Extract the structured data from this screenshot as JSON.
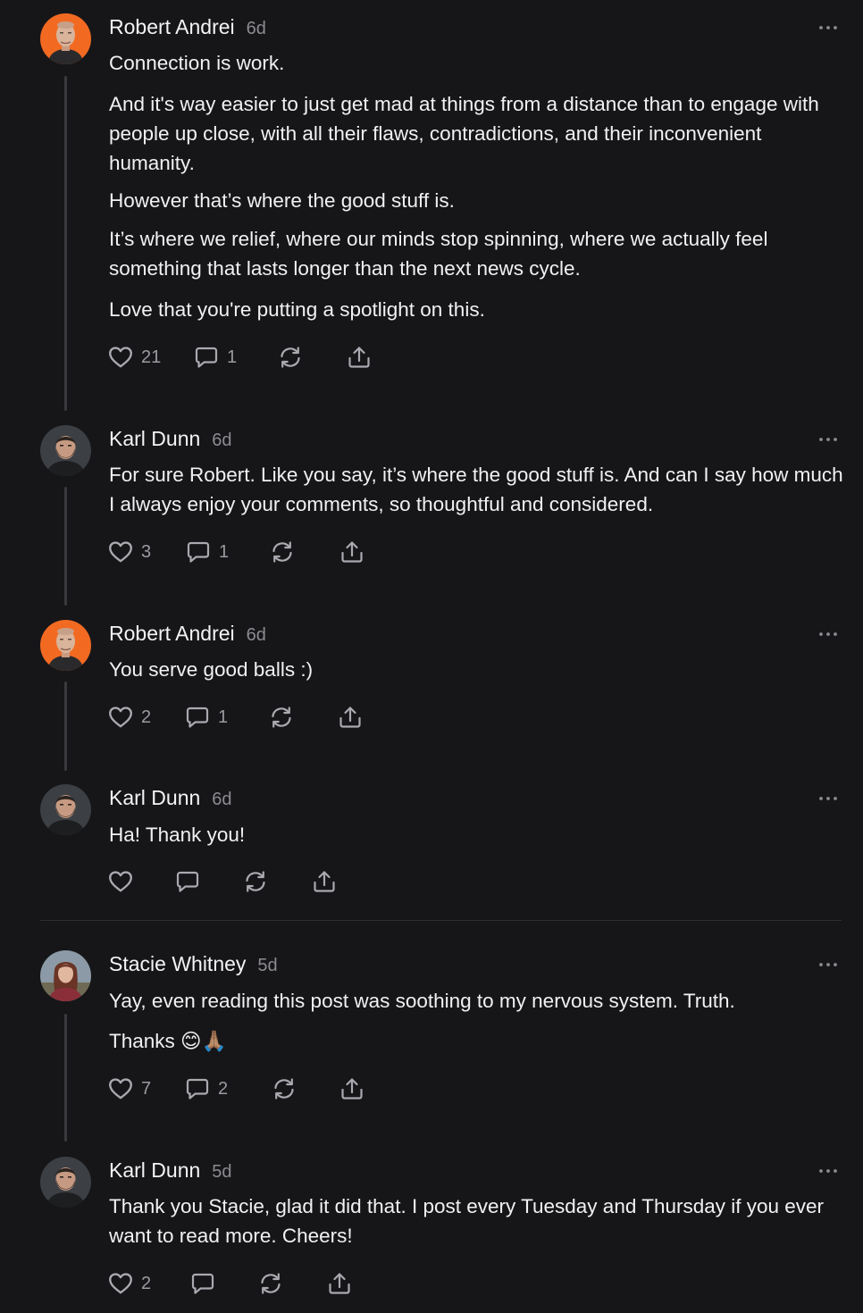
{
  "comments": [
    {
      "author": "Robert Andrei",
      "time": "6d",
      "paragraphs": [
        "Connection is work.",
        "And it's way easier to just get mad at things from a distance than to engage with people up close, with all their flaws, contradictions, and their inconvenient humanity.",
        "However that’s where the good stuff is.",
        "It’s where we relief, where our minds stop spinning, where we actually feel something that lasts longer than the next news cycle.",
        "Love that you're putting a spotlight on this."
      ],
      "likes": "21",
      "replies": "1"
    },
    {
      "author": "Karl Dunn",
      "time": "6d",
      "paragraphs": [
        "For sure Robert. Like you say, it’s where the good stuff is. And can I say how much I always enjoy your comments, so thoughtful and considered."
      ],
      "likes": "3",
      "replies": "1"
    },
    {
      "author": "Robert Andrei",
      "time": "6d",
      "paragraphs": [
        "You serve good balls :)"
      ],
      "likes": "2",
      "replies": "1"
    },
    {
      "author": "Karl Dunn",
      "time": "6d",
      "paragraphs": [
        "Ha! Thank you!"
      ],
      "likes": "",
      "replies": ""
    },
    {
      "author": "Stacie Whitney",
      "time": "5d",
      "paragraphs": [
        "Yay, even reading this post was soothing to my nervous system. Truth.",
        "Thanks 😊🙏🏽"
      ],
      "likes": "7",
      "replies": "2"
    },
    {
      "author": "Karl Dunn",
      "time": "5d",
      "paragraphs": [
        "Thank you Stacie, glad it did that. I post every Tuesday and Thursday if you ever want to read more. Cheers!"
      ],
      "likes": "2",
      "replies": ""
    }
  ],
  "icons": {
    "like": "heart-icon",
    "reply": "speech-bubble-icon",
    "restack": "restack-arrows-icon",
    "share": "share-upload-icon",
    "more": "ellipsis-icon"
  },
  "colors": {
    "background": "#161618",
    "text": "#f1f1f3",
    "muted": "#8b8b92",
    "thread_line": "#3a3a3e",
    "avatar_orange": "#f26a22"
  }
}
